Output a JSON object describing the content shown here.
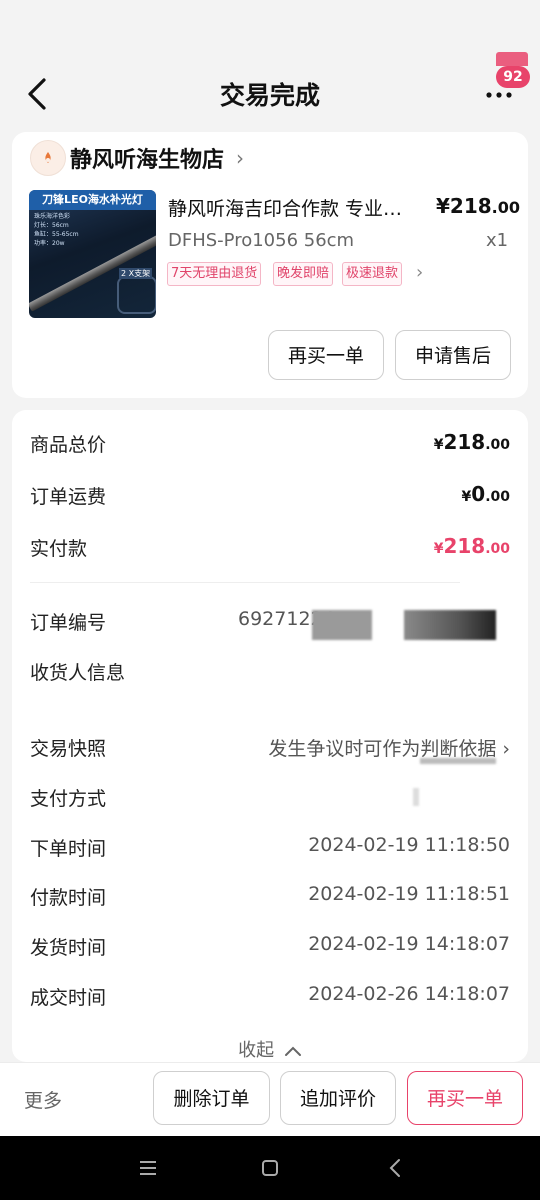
{
  "header": {
    "title": "交易完成",
    "badge_count": "92"
  },
  "shop": {
    "name": "静风听海生物店"
  },
  "product": {
    "thumb_title": "刀锋LEO海水补光灯",
    "thumb_spec": [
      "珠乐海洋色彩",
      "灯长：56cm",
      "鱼缸：55-65cm",
      "功率：20w"
    ],
    "thumb_tag": "2 X支架",
    "name": "静风听海吉印合作款 专业…",
    "price_main": "¥218",
    "price_decimal": ".00",
    "sku": "DFHS-Pro1056  56cm",
    "qty": "x1",
    "tags": [
      "7天无理由退货",
      "晚发即赔",
      "极速退款"
    ]
  },
  "card_actions": {
    "rebuy": "再买一单",
    "aftersale": "申请售后"
  },
  "summary": {
    "goods_total_label": "商品总价",
    "goods_total_yen": "¥",
    "goods_total_int": "218",
    "goods_total_dec": ".00",
    "shipping_label": "订单运费",
    "shipping_yen": "¥",
    "shipping_int": "0",
    "shipping_dec": ".00",
    "paid_label": "实付款",
    "paid_yen": "¥",
    "paid_int": "218",
    "paid_dec": ".00"
  },
  "details": {
    "order_no_label": "订单编号",
    "order_no_value": "69271224",
    "receiver_label": "收货人信息",
    "snapshot_label": "交易快照",
    "snapshot_value": "发生争议时可作为判断依据",
    "payment_label": "支付方式",
    "order_time_label": "下单时间",
    "order_time": "2024-02-19 11:18:50",
    "pay_time_label": "付款时间",
    "pay_time": "2024-02-19 11:18:51",
    "ship_time_label": "发货时间",
    "ship_time": "2024-02-19 14:18:07",
    "done_time_label": "成交时间",
    "done_time": "2024-02-26 14:18:07",
    "collapse": "收起"
  },
  "bottom": {
    "more": "更多",
    "delete": "删除订单",
    "review": "追加评价",
    "rebuy": "再买一单"
  },
  "colors": {
    "accent": "#e8436a",
    "background": "#f3f3f3"
  }
}
